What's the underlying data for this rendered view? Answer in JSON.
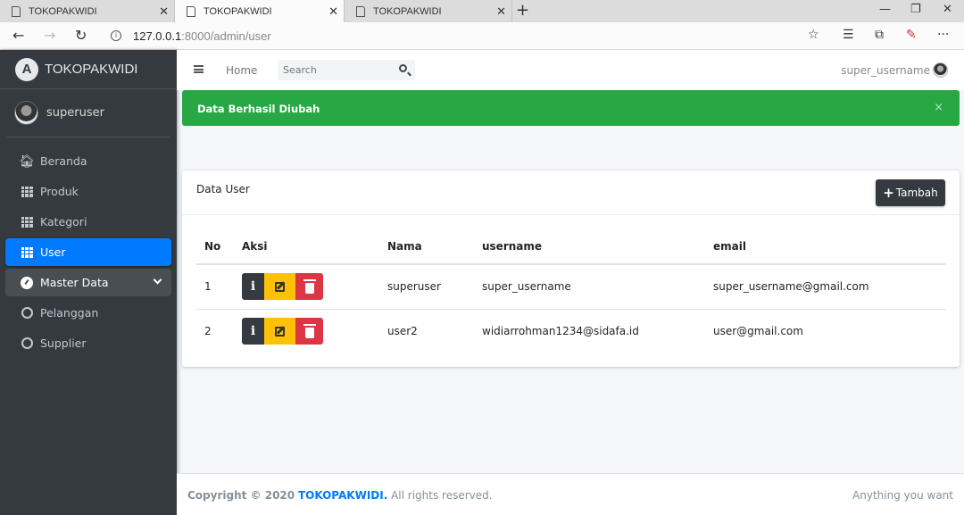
{
  "browser": {
    "tabs": [
      {
        "title": "TOKOPAKWIDI",
        "active": false
      },
      {
        "title": "TOKOPAKWIDI",
        "active": true
      },
      {
        "title": "TOKOPAKWIDI",
        "active": false
      }
    ],
    "url_host": "127.0.0.1",
    "url_rest": ":8000/admin/user"
  },
  "sidebar": {
    "brand": "TOKOPAKWIDI",
    "user": "superuser",
    "items": [
      {
        "label": "Beranda",
        "icon": "home-icon"
      },
      {
        "label": "Produk",
        "icon": "grid-icon"
      },
      {
        "label": "Kategori",
        "icon": "grid-icon"
      },
      {
        "label": "User",
        "icon": "grid-icon",
        "active": true
      },
      {
        "label": "Master Data",
        "icon": "gauge-icon",
        "expanded": true
      },
      {
        "label": "Pelanggan",
        "icon": "circle-icon"
      },
      {
        "label": "Supplier",
        "icon": "circle-icon"
      }
    ]
  },
  "navbar": {
    "home": "Home",
    "search_placeholder": "Search",
    "user": "super_username"
  },
  "alert": {
    "message": "Data Berhasil Diubah",
    "close": "×",
    "color": "#28a745"
  },
  "card": {
    "title": "Data User",
    "add_button": "Tambah",
    "columns": [
      "No",
      "Aksi",
      "Nama",
      "username",
      "email"
    ],
    "rows": [
      {
        "no": "1",
        "nama": "superuser",
        "username": "super_username",
        "email": "super_username@gmail.com"
      },
      {
        "no": "2",
        "nama": "user2",
        "username": "widiarrohman1234@sidafa.id",
        "email": "user@gmail.com"
      }
    ]
  },
  "footer": {
    "copyright": "Copyright © 2020",
    "brand": "TOKOPAKWIDI.",
    "rights": "All rights reserved.",
    "right_text": "Anything you want"
  },
  "colors": {
    "sidebar_bg": "#343a40",
    "active_blue": "#007bff",
    "info_btn": "#343a40",
    "edit_btn": "#ffc107",
    "delete_btn": "#dc3545"
  }
}
